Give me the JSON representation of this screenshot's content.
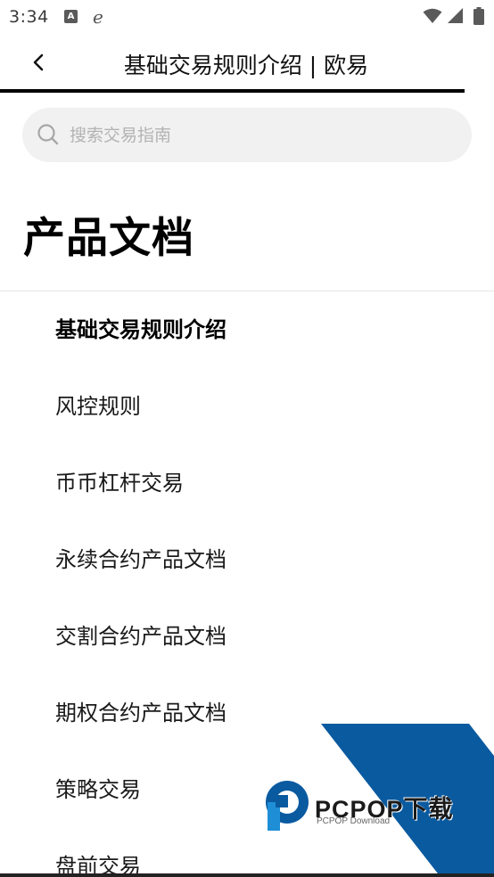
{
  "status_bar": {
    "time": "3:34",
    "a_badge": "A",
    "e_badge": "e"
  },
  "header": {
    "title": "基础交易规则介绍 | 欧易",
    "back_icon": "chevron-left-icon"
  },
  "search": {
    "placeholder": "搜索交易指南",
    "value": ""
  },
  "page_heading": "产品文档",
  "nav": {
    "items": [
      {
        "label": "基础交易规则介绍",
        "active": true
      },
      {
        "label": "风控规则",
        "active": false
      },
      {
        "label": "币币杠杆交易",
        "active": false
      },
      {
        "label": "永续合约产品文档",
        "active": false
      },
      {
        "label": "交割合约产品文档",
        "active": false
      },
      {
        "label": "期权合约产品文档",
        "active": false
      },
      {
        "label": "策略交易",
        "active": false
      },
      {
        "label": "盘前交易",
        "active": false
      }
    ]
  },
  "watermark": {
    "text": "PCPOP下载",
    "sub": "PCPOP Download"
  },
  "colors": {
    "accent_blue": "#0a5aa0",
    "search_bg": "#f1f1f1"
  }
}
